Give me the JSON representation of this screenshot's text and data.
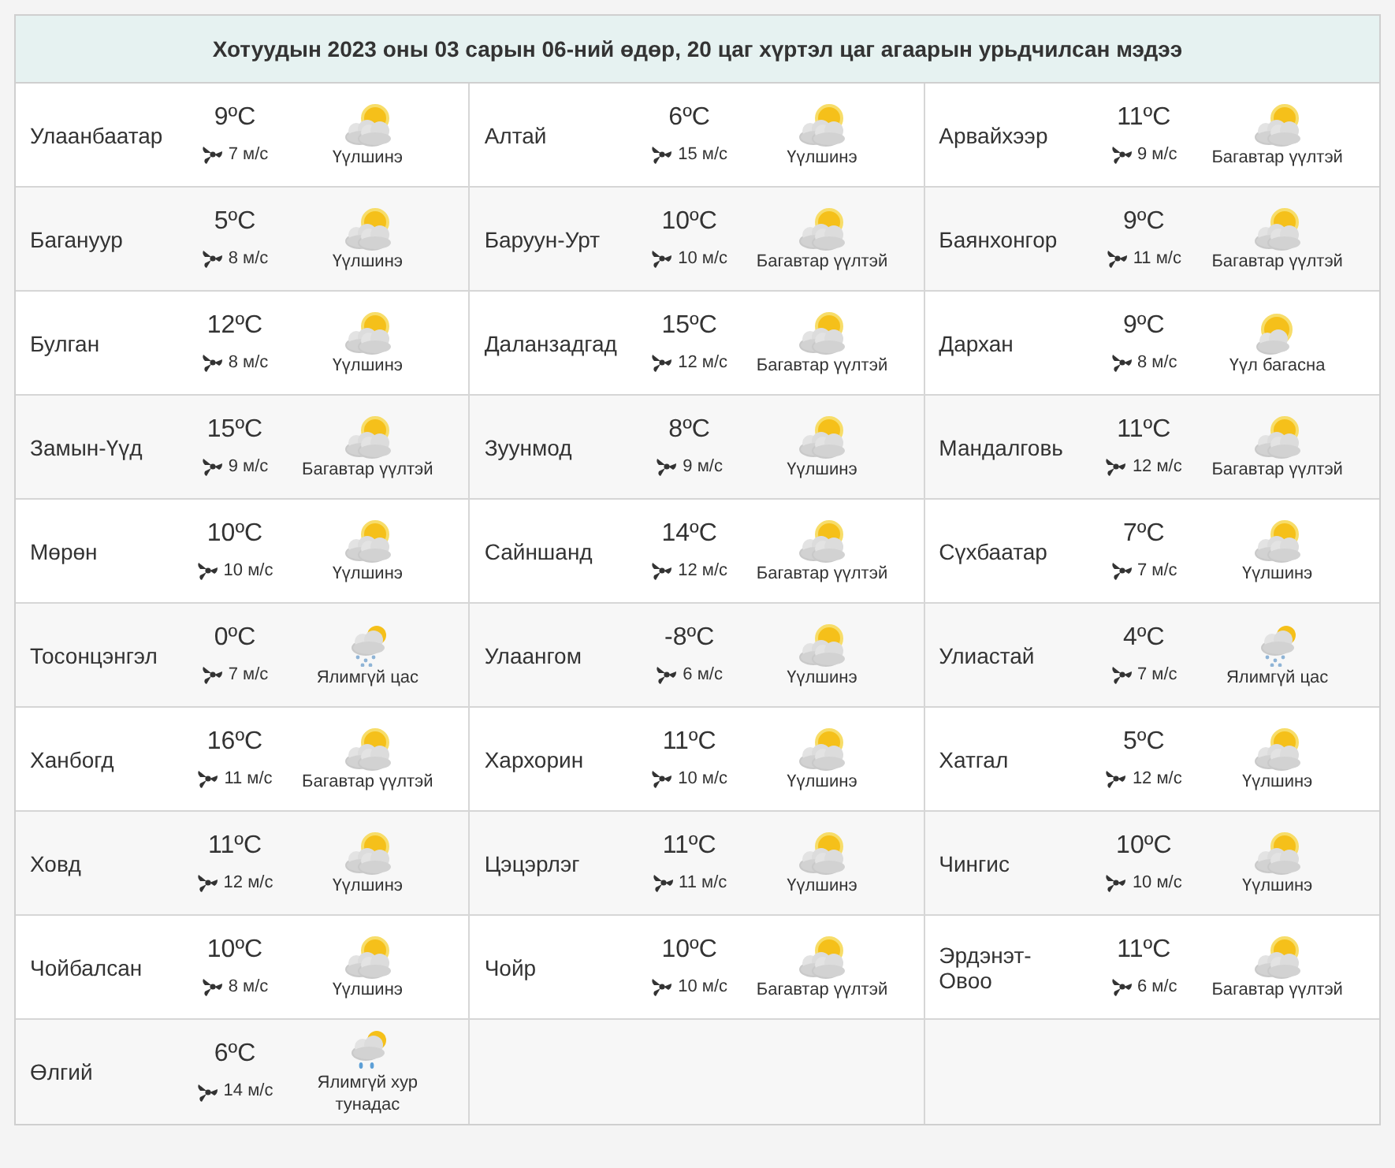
{
  "title": "Хотуудын 2023 оны 03 сарын 06-ний өдөр, 20 цаг хүртэл цаг агаарын урьдчилсан мэдээ",
  "cities": [
    {
      "name": "Улаанбаатар",
      "temp": "9ºC",
      "wind": "7 м/с",
      "condition": "Үүлшинэ",
      "kind": "cloudy"
    },
    {
      "name": "Алтай",
      "temp": "6ºC",
      "wind": "15 м/с",
      "condition": "Үүлшинэ",
      "kind": "cloudy"
    },
    {
      "name": "Арвайхээр",
      "temp": "11ºC",
      "wind": "9 м/с",
      "condition": "Багавтар үүлтэй",
      "kind": "cloudy"
    },
    {
      "name": "Багануур",
      "temp": "5ºC",
      "wind": "8 м/с",
      "condition": "Үүлшинэ",
      "kind": "cloudy"
    },
    {
      "name": "Баруун-Урт",
      "temp": "10ºC",
      "wind": "10 м/с",
      "condition": "Багавтар үүлтэй",
      "kind": "cloudy"
    },
    {
      "name": "Баянхонгор",
      "temp": "9ºC",
      "wind": "11 м/с",
      "condition": "Багавтар үүлтэй",
      "kind": "cloudy"
    },
    {
      "name": "Булган",
      "temp": "12ºC",
      "wind": "8 м/с",
      "condition": "Үүлшинэ",
      "kind": "cloudy"
    },
    {
      "name": "Даланзадгад",
      "temp": "15ºC",
      "wind": "12 м/с",
      "condition": "Багавтар үүлтэй",
      "kind": "cloudy"
    },
    {
      "name": "Дархан",
      "temp": "9ºC",
      "wind": "8 м/с",
      "condition": "Үүл багасна",
      "kind": "sun"
    },
    {
      "name": "Замын-Үүд",
      "temp": "15ºC",
      "wind": "9 м/с",
      "condition": "Багавтар үүлтэй",
      "kind": "cloudy"
    },
    {
      "name": "Зуунмод",
      "temp": "8ºC",
      "wind": "9 м/с",
      "condition": "Үүлшинэ",
      "kind": "cloudy"
    },
    {
      "name": "Мандалговь",
      "temp": "11ºC",
      "wind": "12 м/с",
      "condition": "Багавтар үүлтэй",
      "kind": "cloudy"
    },
    {
      "name": "Мөрөн",
      "temp": "10ºC",
      "wind": "10 м/с",
      "condition": "Үүлшинэ",
      "kind": "cloudy"
    },
    {
      "name": "Сайншанд",
      "temp": "14ºC",
      "wind": "12 м/с",
      "condition": "Багавтар үүлтэй",
      "kind": "cloudy"
    },
    {
      "name": "Сүхбаатар",
      "temp": "7ºC",
      "wind": "7 м/с",
      "condition": "Үүлшинэ",
      "kind": "cloudy"
    },
    {
      "name": "Тосонцэнгэл",
      "temp": "0ºC",
      "wind": "7 м/с",
      "condition": "Ялимгүй цас",
      "kind": "snow"
    },
    {
      "name": "Улаангом",
      "temp": "-8ºC",
      "wind": "6 м/с",
      "condition": "Үүлшинэ",
      "kind": "cloudy"
    },
    {
      "name": "Улиастай",
      "temp": "4ºC",
      "wind": "7 м/с",
      "condition": "Ялимгүй цас",
      "kind": "snow"
    },
    {
      "name": "Ханбогд",
      "temp": "16ºC",
      "wind": "11 м/с",
      "condition": "Багавтар үүлтэй",
      "kind": "cloudy"
    },
    {
      "name": "Хархорин",
      "temp": "11ºC",
      "wind": "10 м/с",
      "condition": "Үүлшинэ",
      "kind": "cloudy"
    },
    {
      "name": "Хатгал",
      "temp": "5ºC",
      "wind": "12 м/с",
      "condition": "Үүлшинэ",
      "kind": "cloudy"
    },
    {
      "name": "Ховд",
      "temp": "11ºC",
      "wind": "12 м/с",
      "condition": "Үүлшинэ",
      "kind": "cloudy"
    },
    {
      "name": "Цэцэрлэг",
      "temp": "11ºC",
      "wind": "11 м/с",
      "condition": "Үүлшинэ",
      "kind": "cloudy"
    },
    {
      "name": "Чингис",
      "temp": "10ºC",
      "wind": "10 м/с",
      "condition": "Үүлшинэ",
      "kind": "cloudy"
    },
    {
      "name": "Чойбалсан",
      "temp": "10ºC",
      "wind": "8 м/с",
      "condition": "Үүлшинэ",
      "kind": "cloudy"
    },
    {
      "name": "Чойр",
      "temp": "10ºC",
      "wind": "10 м/с",
      "condition": "Багавтар үүлтэй",
      "kind": "cloudy"
    },
    {
      "name": "Эрдэнэт-Овоо",
      "temp": "11ºC",
      "wind": "6 м/с",
      "condition": "Багавтар үүлтэй",
      "kind": "cloudy"
    },
    {
      "name": "Өлгий",
      "temp": "6ºC",
      "wind": "14 м/с",
      "condition": "Ялимгүй хур тунадас",
      "kind": "rain"
    }
  ]
}
